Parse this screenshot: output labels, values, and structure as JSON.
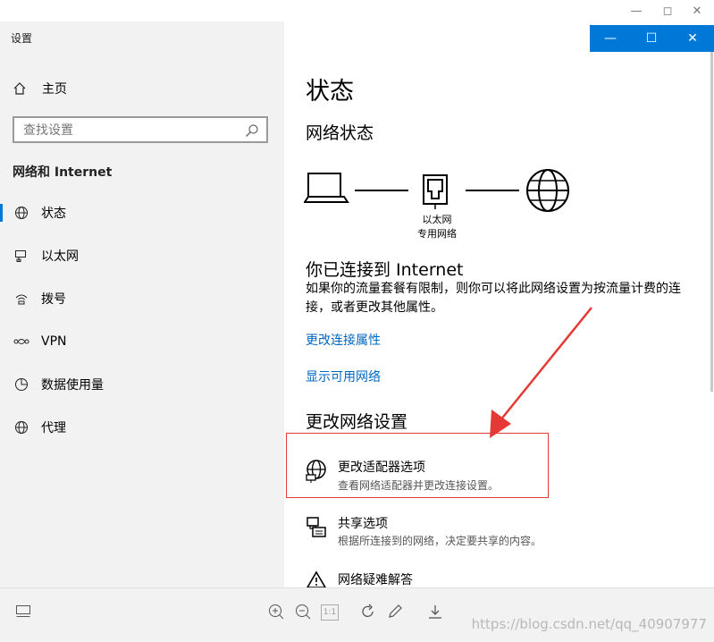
{
  "app_title": "设置",
  "window_controls": {
    "minimize": "—",
    "maximize": "☐",
    "close": "✕"
  },
  "sidebar": {
    "home_label": "主页",
    "search_placeholder": "查找设置",
    "section_title": "网络和 Internet",
    "items": [
      {
        "label": "状态",
        "icon": "globe-icon",
        "active": true
      },
      {
        "label": "以太网",
        "icon": "ethernet-icon",
        "active": false
      },
      {
        "label": "拨号",
        "icon": "dialup-icon",
        "active": false
      },
      {
        "label": "VPN",
        "icon": "vpn-icon",
        "active": false
      },
      {
        "label": "数据使用量",
        "icon": "data-usage-icon",
        "active": false
      },
      {
        "label": "代理",
        "icon": "proxy-globe-icon",
        "active": false
      }
    ]
  },
  "main": {
    "page_title": "状态",
    "network_status_title": "网络状态",
    "diagram": {
      "line1": "以太网",
      "line2": "专用网络"
    },
    "connected_title": "你已连接到 Internet",
    "connected_desc": "如果你的流量套餐有限制，则你可以将此网络设置为按流量计费的连接，或者更改其他属性。",
    "link_change_props": "更改连接属性",
    "link_show_networks": "显示可用网络",
    "change_settings_title": "更改网络设置",
    "options": [
      {
        "title": "更改适配器选项",
        "desc": "查看网络适配器并更改连接设置。",
        "icon": "adapter-icon",
        "highlighted": true
      },
      {
        "title": "共享选项",
        "desc": "根据所连接到的网络，决定要共享的内容。",
        "icon": "sharing-icon",
        "highlighted": false
      },
      {
        "title": "网络疑难解答",
        "desc": "",
        "icon": "warning-icon",
        "highlighted": false
      }
    ]
  },
  "viewer": {
    "watermark": "https://blog.csdn.net/qq_40907977",
    "tools": [
      "thumbnail-icon",
      "zoom-in-icon",
      "zoom-out-icon",
      "actual-size-icon",
      "rotate-icon",
      "edit-icon",
      "download-icon"
    ],
    "actual_size_label": "1:1"
  },
  "colors": {
    "accent": "#0078d7",
    "link": "#0067c0",
    "highlight_box": "#e53935",
    "sidebar_bg": "#f2f2f2"
  }
}
